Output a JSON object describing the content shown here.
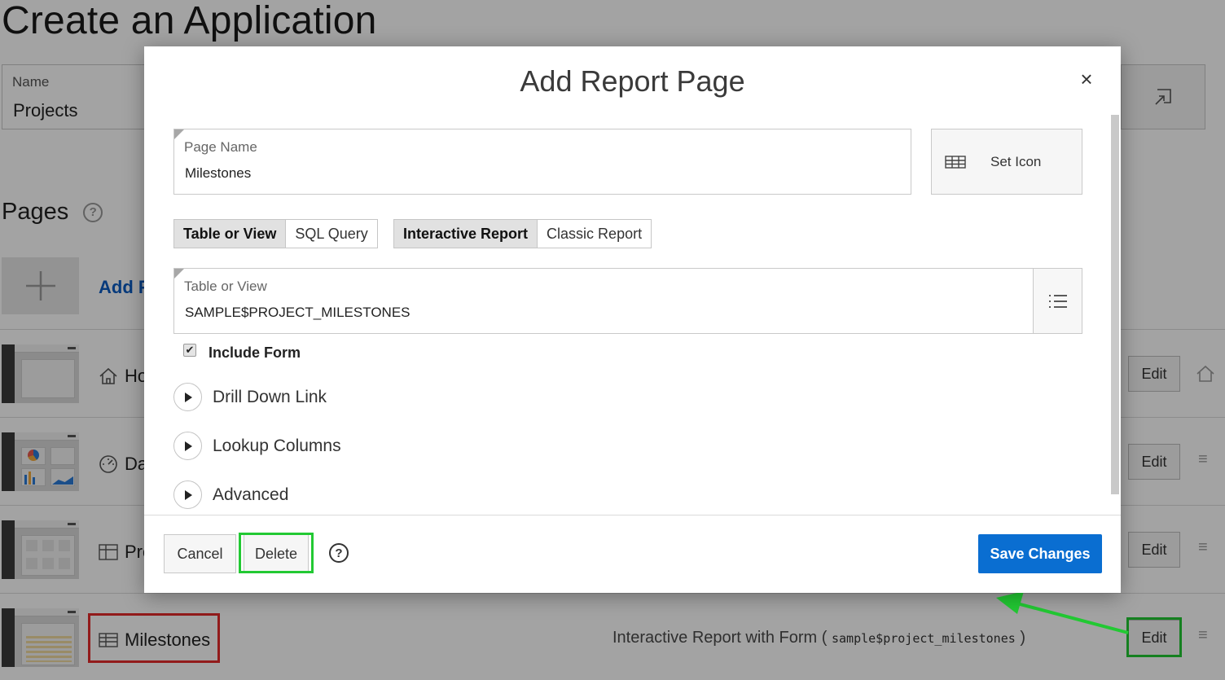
{
  "app": {
    "title": "Create an Application",
    "name_label": "Name",
    "name_value": "Projects"
  },
  "pages": {
    "title": "Pages",
    "help_symbol": "?",
    "add_label": "Add P",
    "rows": [
      {
        "label": "Ho",
        "icon": "home-icon"
      },
      {
        "label": "Da",
        "icon": "dashboard-icon"
      },
      {
        "label": "Pro",
        "icon": "grid-icon"
      },
      {
        "label": "Milestones",
        "icon": "table-icon",
        "description": "Interactive Report with Form (",
        "description_code": "sample$project_milestones",
        "description_end": ")"
      }
    ],
    "edit_label": "Edit"
  },
  "dialog": {
    "title": "Add Report Page",
    "close_symbol": "×",
    "page_name_label": "Page Name",
    "page_name_value": "Milestones",
    "set_icon_label": "Set Icon",
    "source_tabs": [
      "Table or View",
      "SQL Query"
    ],
    "source_selected": "Table or View",
    "report_tabs": [
      "Interactive Report",
      "Classic Report"
    ],
    "report_selected": "Interactive Report",
    "table_label": "Table or View",
    "table_value": "SAMPLE$PROJECT_MILESTONES",
    "include_form_label": "Include Form",
    "include_form_checked": true,
    "collapsibles": [
      "Drill Down Link",
      "Lookup Columns",
      "Advanced"
    ],
    "cancel_label": "Cancel",
    "delete_label": "Delete",
    "help_symbol": "?",
    "save_label": "Save Changes"
  },
  "colors": {
    "primary": "#0a6ed1",
    "link": "#0a5bc2",
    "highlight_green": "#22c933",
    "highlight_red": "#e52b2b"
  }
}
